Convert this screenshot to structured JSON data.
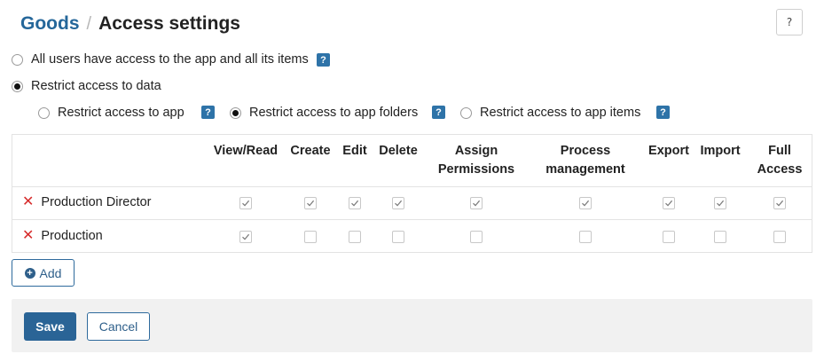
{
  "header": {
    "app_name": "Goods",
    "separator": "/",
    "page_title": "Access settings",
    "help_icon": "?"
  },
  "access_mode": {
    "options": [
      {
        "label": "All users have access to the app and all its items",
        "selected": false
      },
      {
        "label": "Restrict access to data",
        "selected": true
      }
    ],
    "help_badge": "?"
  },
  "restrict_type": {
    "options": [
      {
        "label": "Restrict access to app",
        "selected": false
      },
      {
        "label": "Restrict access to app folders",
        "selected": true
      },
      {
        "label": "Restrict access to app items",
        "selected": false
      }
    ],
    "help_badge": "?"
  },
  "permissions_table": {
    "columns": [
      {
        "line1": "View/Read",
        "line2": ""
      },
      {
        "line1": "Create",
        "line2": ""
      },
      {
        "line1": "Edit",
        "line2": ""
      },
      {
        "line1": "Delete",
        "line2": ""
      },
      {
        "line1": "Assign",
        "line2": "Permissions"
      },
      {
        "line1": "Process",
        "line2": "management"
      },
      {
        "line1": "Export",
        "line2": ""
      },
      {
        "line1": "Import",
        "line2": ""
      },
      {
        "line1": "Full",
        "line2": "Access"
      }
    ],
    "rows": [
      {
        "name": "Production Director",
        "remove_icon": "✕",
        "checks": [
          true,
          true,
          true,
          true,
          true,
          true,
          true,
          true,
          true
        ]
      },
      {
        "name": "Production",
        "remove_icon": "✕",
        "checks": [
          true,
          false,
          false,
          false,
          false,
          false,
          false,
          false,
          false
        ]
      }
    ]
  },
  "actions": {
    "add_label": "Add",
    "add_icon": "+",
    "save_label": "Save",
    "cancel_label": "Cancel"
  },
  "colors": {
    "accent": "#2a6496",
    "link": "#25679a",
    "remove": "#d62b2b",
    "footer_bg": "#f1f1f1"
  }
}
